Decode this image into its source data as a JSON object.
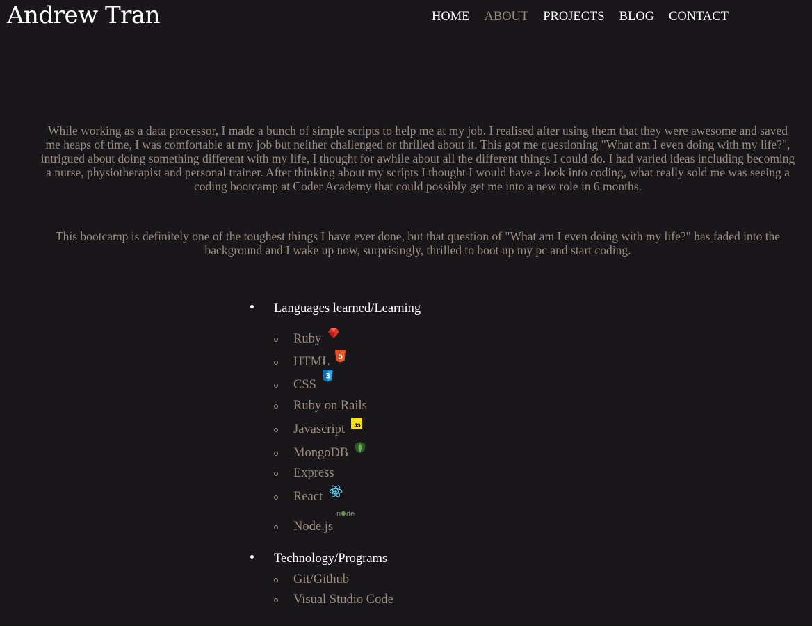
{
  "header": {
    "title": "Andrew Tran",
    "nav": [
      "HOME",
      "ABOUT",
      "PROJECTS",
      "BLOG",
      "CONTACT"
    ],
    "active_nav": "ABOUT"
  },
  "intro": {
    "paragraph1": "While working as a data processor, I made a bunch of simple scripts to help me at my job. I realised after using them that they were awesome and saved me heaps of time, I was comfortable at my job but neither challenged or thrilled about it. This got me questioning \"What am I even doing with my life?\", intrigued about doing something different with my life, I thought for awhile about all the different things I could do. I had varied ideas including becoming a nurse, physiotherapist and personal trainer. After thinking about my scripts I thought I would have a look into coding, what really sold me was seeing a coding bootcamp at Coder Academy that could possibly get me into a new role in 6 months.",
    "paragraph2": "This bootcamp is definitely one of the toughest things I have ever done, but that question of \"What am I even doing with my life?\" has faded into the background and I wake up now, surprisingly, thrilled to boot up my pc and start coding."
  },
  "skills": {
    "languages": {
      "label": "Languages learned/Learning",
      "items": [
        {
          "name": "Ruby",
          "icon": "ruby-icon"
        },
        {
          "name": "HTML",
          "icon": "html5-icon"
        },
        {
          "name": "CSS",
          "icon": "css3-icon"
        },
        {
          "name": "Ruby on Rails",
          "icon": ""
        },
        {
          "name": "Javascript",
          "icon": "javascript-icon"
        },
        {
          "name": "MongoDB",
          "icon": "mongodb-icon"
        },
        {
          "name": "Express",
          "icon": ""
        },
        {
          "name": "React",
          "icon": "react-icon"
        },
        {
          "name": "Node.js",
          "icon": "nodejs-icon"
        }
      ]
    },
    "technology": {
      "label": "Technology/Programs",
      "items": [
        {
          "name": "Git/Github"
        },
        {
          "name": "Visual Studio Code"
        }
      ]
    }
  },
  "colors": {
    "background": "#1a171b",
    "text_muted": "#9a8c80",
    "text_primary": "#ffffff"
  }
}
